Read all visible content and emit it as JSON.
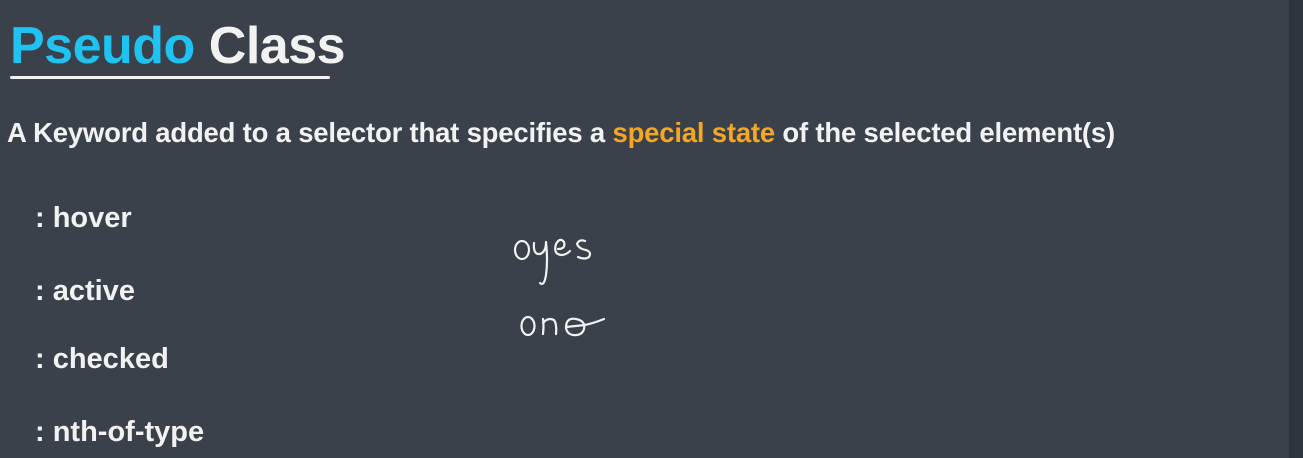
{
  "title": {
    "word1": "Pseudo",
    "word2": "Class",
    "word1_color": "#1fc3f1",
    "word2_color": "#f2f2f2"
  },
  "definition": {
    "before": "A Keyword added to a selector that specifies a ",
    "highlight": "special state",
    "after": " of the selected element(s)",
    "highlight_color": "#f5a623"
  },
  "pseudo_classes": [
    ": hover",
    ": active",
    ": checked",
    ": nth-of-type"
  ],
  "handwritten_note": {
    "option_yes": "yes",
    "option_no": "no"
  },
  "colors": {
    "background": "#3a414b",
    "text": "#f2f2f2"
  }
}
